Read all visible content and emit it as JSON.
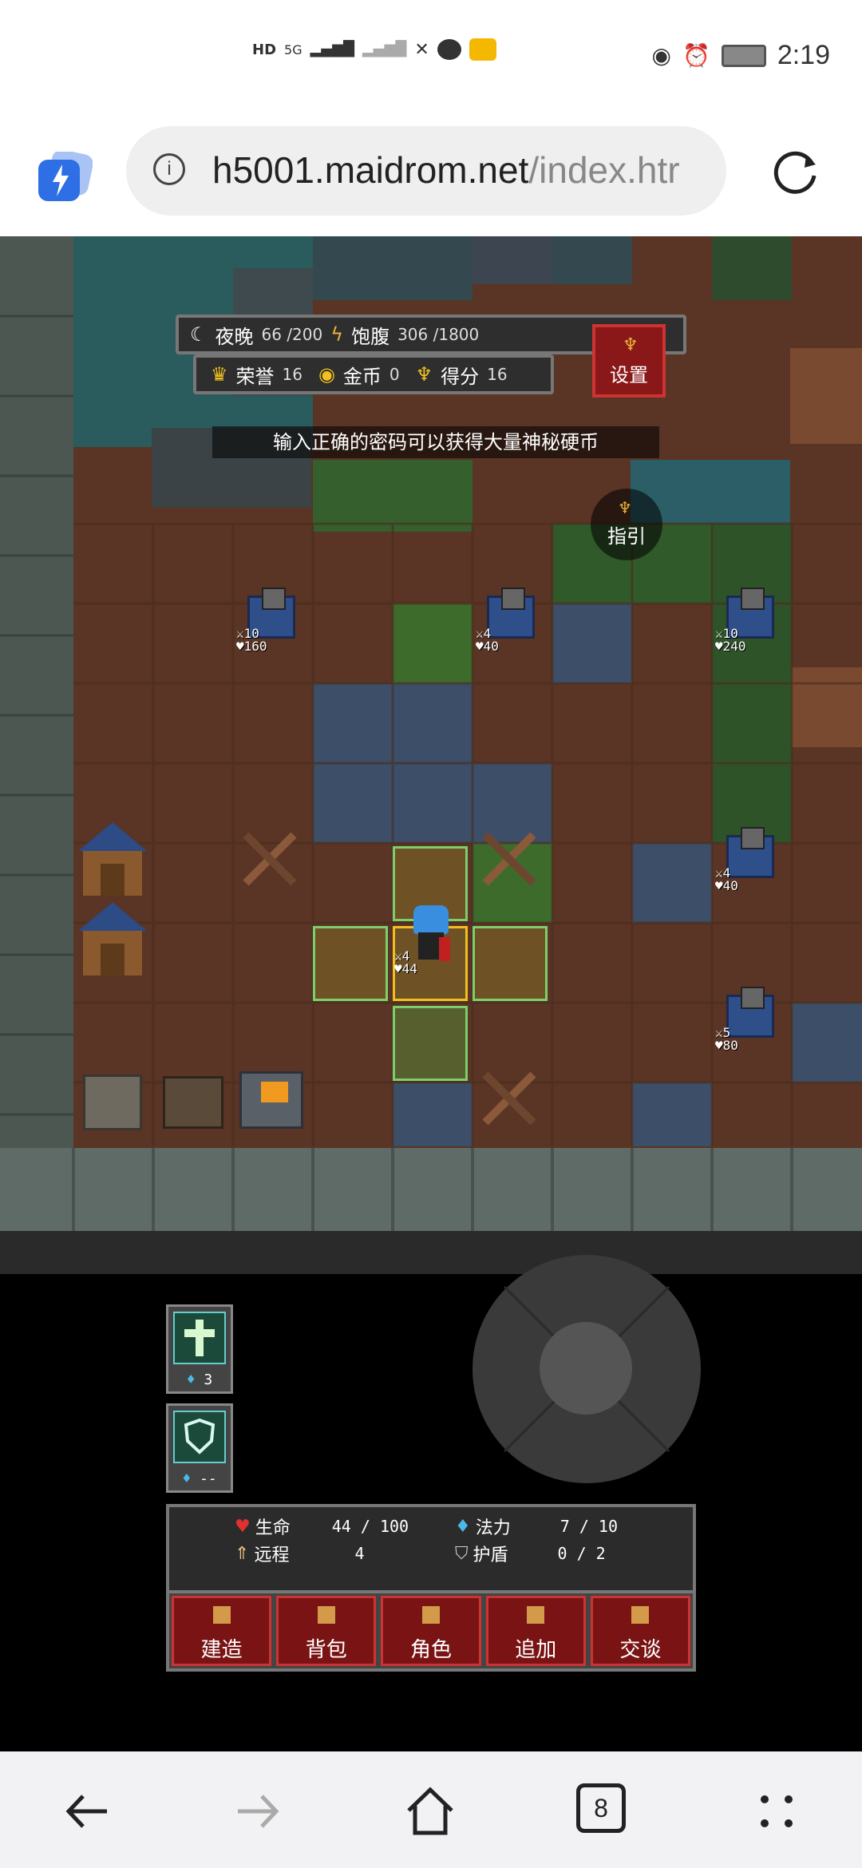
{
  "status_bar": {
    "left_label_1": "HD",
    "left_label_2": "5G",
    "time": "2:19"
  },
  "browser": {
    "url_host": "h5001.maidrom.net",
    "url_path": "/index.htr",
    "tab_count": "8"
  },
  "hud": {
    "night_label": "夜晚",
    "night_value": "66 /200",
    "full_label": "饱腹",
    "full_value": "306 /1800",
    "honor_label": "荣誉",
    "honor_value": "16",
    "gold_label": "金币",
    "gold_value": "0",
    "score_label": "得分",
    "score_value": "16",
    "settings_label": "设置"
  },
  "notice": "输入正确的密码可以获得大量神秘硬币",
  "guide_label": "指引",
  "units": [
    {
      "atk": "10",
      "hp": "160"
    },
    {
      "atk": "4",
      "hp": "40"
    },
    {
      "atk": "10",
      "hp": "240"
    },
    {
      "atk": "4",
      "hp": "40"
    },
    {
      "atk": "5",
      "hp": "80"
    }
  ],
  "hero": {
    "atk": "4",
    "hp": "44"
  },
  "skills": [
    {
      "name": "holy-cross",
      "count": "3"
    },
    {
      "name": "shield",
      "count": "--"
    }
  ],
  "stats": {
    "life_label": "生命",
    "life_value": "44 / 100",
    "mana_label": "法力",
    "mana_value": "7  /  10",
    "range_label": "远程",
    "range_value": "4",
    "shield_label": "护盾",
    "shield_value": "0  /  2"
  },
  "actions": [
    "建造",
    "背包",
    "角色",
    "追加",
    "交谈"
  ],
  "colors": {
    "accent_red": "#7a1414",
    "hud_bg": "#2e2e2e",
    "select_green": "#7ccf6a",
    "select_gold": "#f0c020"
  }
}
